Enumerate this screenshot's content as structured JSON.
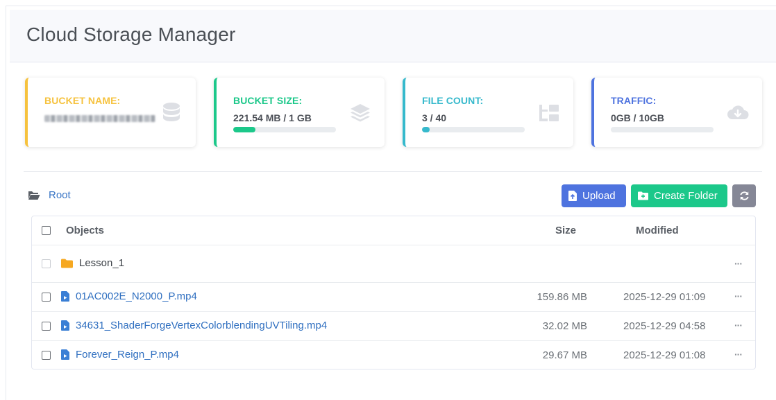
{
  "app": {
    "title": "Cloud Storage Manager"
  },
  "colors": {
    "yellow": "#f6c23e",
    "green": "#1cc88a",
    "teal": "#36b9cc",
    "blue": "#4e73df",
    "gray": "#858796"
  },
  "stats": [
    {
      "label": "BUCKET NAME:",
      "value": "",
      "icon": "database-icon",
      "color": "#f6c23e"
    },
    {
      "label": "BUCKET SIZE:",
      "value": "221.54 MB / 1 GB",
      "progress": 0.216,
      "icon": "layers-icon",
      "color": "#1cc88a"
    },
    {
      "label": "FILE COUNT:",
      "value": "3 / 40",
      "progress": 0.075,
      "icon": "sitemap-icon",
      "color": "#36b9cc"
    },
    {
      "label": "TRAFFIC:",
      "value": "0GB / 10GB",
      "progress": 0,
      "icon": "cloud-download-icon",
      "color": "#4e73df"
    }
  ],
  "breadcrumb": {
    "label": "Root",
    "icon": "folder-open-icon"
  },
  "toolbar": {
    "upload_label": "Upload",
    "create_folder_label": "Create Folder",
    "refresh_icon": "refresh-icon"
  },
  "table": {
    "headers": {
      "objects": "Objects",
      "size": "Size",
      "modified": "Modified"
    },
    "rows": [
      {
        "type": "folder",
        "name": "Lesson_1",
        "size": "",
        "modified": "",
        "actions": "···"
      },
      {
        "type": "file",
        "name": "01AC002E_N2000_P.mp4",
        "size": "159.86 MB",
        "modified": "2025-12-29 01:09",
        "actions": "···"
      },
      {
        "type": "file",
        "name": "34631_ShaderForgeVertexColorblendingUVTiling.mp4",
        "size": "32.02 MB",
        "modified": "2025-12-29 04:58",
        "actions": "···"
      },
      {
        "type": "file",
        "name": "Forever_Reign_P.mp4",
        "size": "29.67 MB",
        "modified": "2025-12-29 01:08",
        "actions": "···"
      }
    ]
  }
}
